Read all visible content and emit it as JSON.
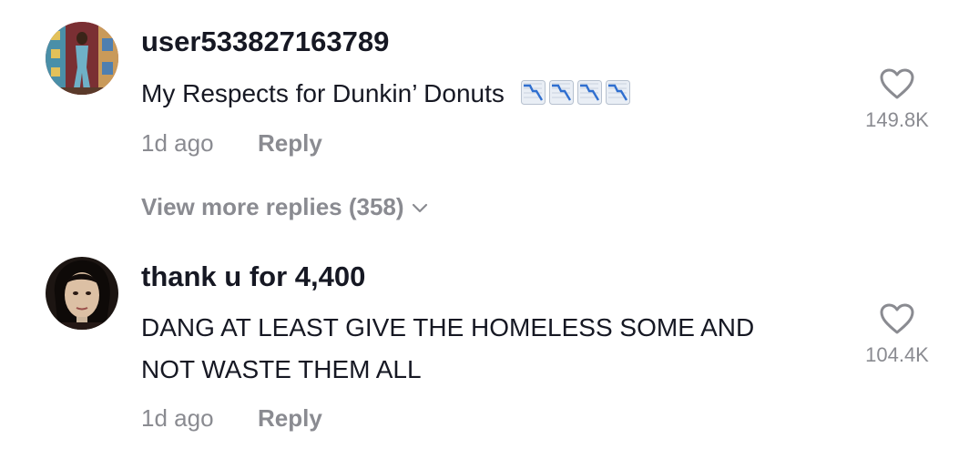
{
  "comments": [
    {
      "username": "user533827163789",
      "text": "My Respects for Dunkin’ Donuts",
      "emoji": "chart-decreasing-emoji",
      "emoji_count": 4,
      "age": "1d ago",
      "reply_label": "Reply",
      "likes": "149.8K"
    },
    {
      "username": "thank u for 4,400",
      "text_line1": "DANG AT LEAST GIVE THE HOMELESS SOME AND",
      "text_line2": "NOT WASTE THEM ALL",
      "age": "1d ago",
      "reply_label": "Reply",
      "likes": "104.4K"
    }
  ],
  "view_more_replies": "View more replies (358)",
  "icons": {
    "like": "heart-outline-icon",
    "expand": "chevron-down-icon"
  },
  "colors": {
    "primary_text": "#161823",
    "secondary_text": "#8a8b91"
  }
}
